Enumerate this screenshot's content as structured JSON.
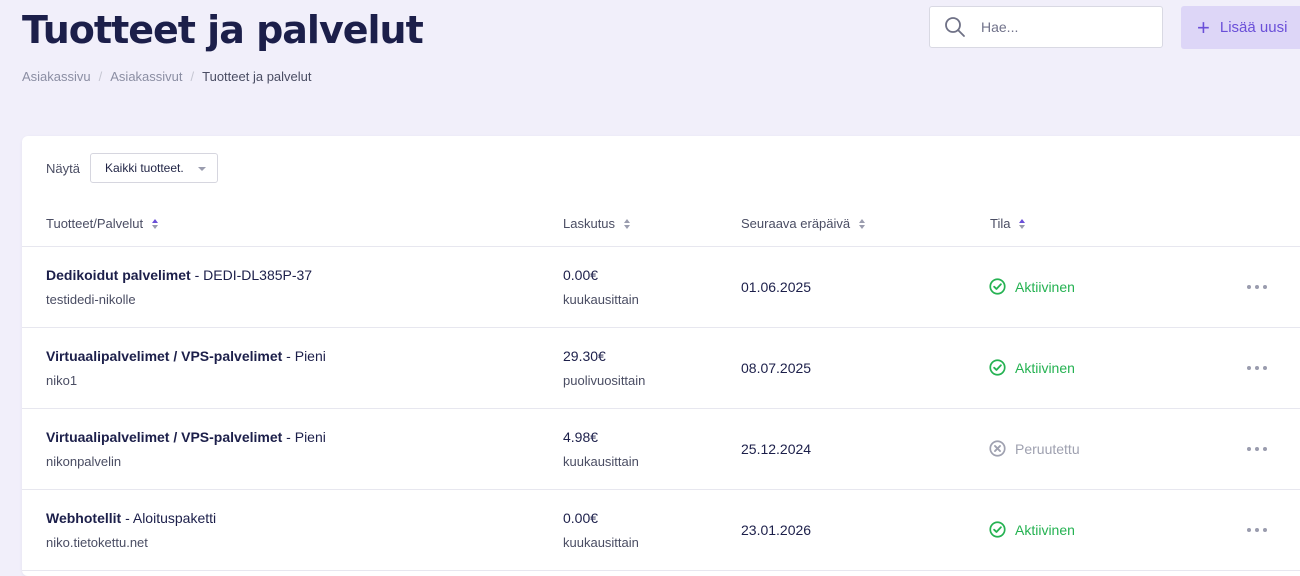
{
  "page": {
    "title": "Tuotteet ja palvelut"
  },
  "breadcrumb": [
    "Asiakassivu",
    "Asiakassivut",
    "Tuotteet ja palvelut"
  ],
  "search": {
    "placeholder": "Hae...",
    "icon": "search-icon"
  },
  "add_button": {
    "label": "Lisää uusi",
    "icon": "plus-icon"
  },
  "filter": {
    "label": "Näytä",
    "selected": "Kaikki tuotteet."
  },
  "columns": [
    "Tuotteet/Palvelut",
    "Laskutus",
    "Seuraava eräpäivä",
    "Tila"
  ],
  "rows": [
    {
      "category": "Dedikoidut palvelimet",
      "product": " - DEDI-DL385P-37",
      "identifier": "testidedi-nikolle",
      "price": "0.00€",
      "cycle": "kuukausittain",
      "due": "01.06.2025",
      "status": "Aktiivinen",
      "status_type": "active"
    },
    {
      "category": "Virtuaalipalvelimet / VPS-palvelimet",
      "product": " - Pieni",
      "identifier": "niko1",
      "price": "29.30€",
      "cycle": "puolivuosittain",
      "due": "08.07.2025",
      "status": "Aktiivinen",
      "status_type": "active"
    },
    {
      "category": "Virtuaalipalvelimet / VPS-palvelimet",
      "product": " - Pieni",
      "identifier": "nikonpalvelin",
      "price": "4.98€",
      "cycle": "kuukausittain",
      "due": "25.12.2024",
      "status": "Peruutettu",
      "status_type": "cancelled"
    },
    {
      "category": "Webhotellit",
      "product": " - Aloituspaketti",
      "identifier": "niko.tietokettu.net",
      "price": "0.00€",
      "cycle": "kuukausittain",
      "due": "23.01.2026",
      "status": "Aktiivinen",
      "status_type": "active"
    }
  ],
  "colors": {
    "accent": "#6a4fd8",
    "active": "#25b252",
    "cancelled": "#9fa1b0",
    "background": "#f1effa"
  }
}
